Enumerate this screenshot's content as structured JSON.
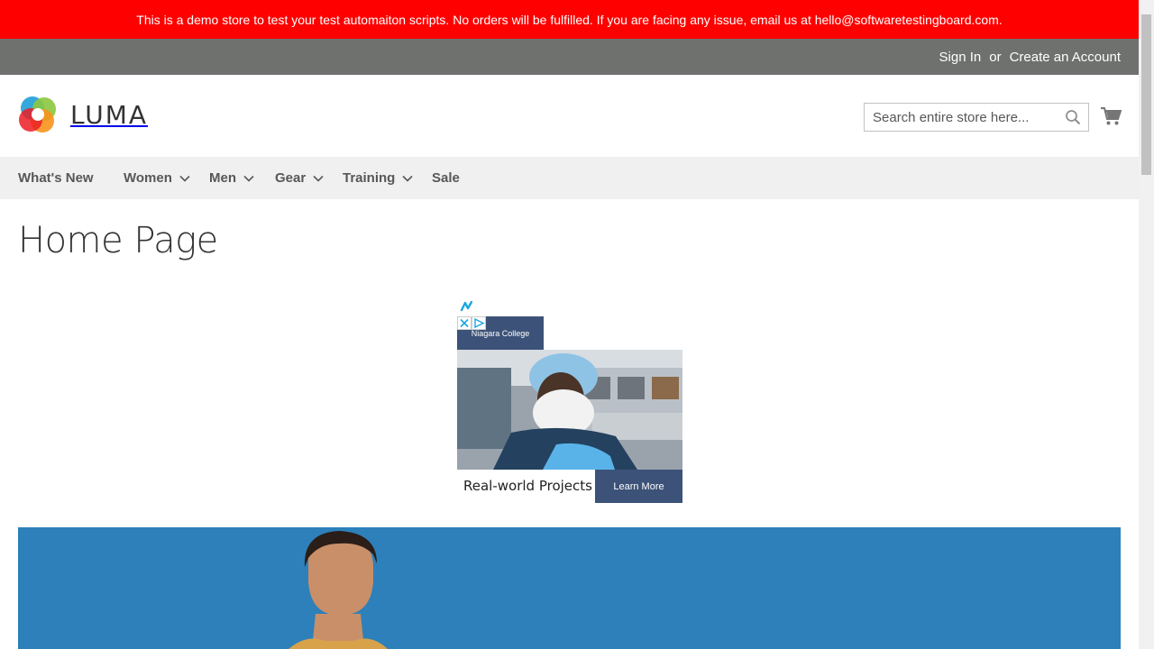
{
  "banner": {
    "text": "This is a demo store to test your test automaiton scripts. No orders will be fulfilled. If you are facing any issue, email us at hello@softwaretestingboard.com."
  },
  "header_links": {
    "sign_in": "Sign In",
    "or": "or",
    "create_account": "Create an Account"
  },
  "logo": {
    "text": "LUMA"
  },
  "search": {
    "placeholder": "Search entire store here..."
  },
  "nav": {
    "items": [
      {
        "label": "What's New",
        "has_dropdown": false
      },
      {
        "label": "Women",
        "has_dropdown": true
      },
      {
        "label": "Men",
        "has_dropdown": true
      },
      {
        "label": "Gear",
        "has_dropdown": true
      },
      {
        "label": "Training",
        "has_dropdown": true
      },
      {
        "label": "Sale",
        "has_dropdown": false
      }
    ]
  },
  "page": {
    "title": "Home Page"
  },
  "ad": {
    "advertiser": "Niagara College",
    "tagline": "Real-world Projects",
    "cta": "Learn More"
  },
  "icons": {
    "search": "search-icon",
    "cart": "cart-icon",
    "chevron": "chevron-down-icon"
  },
  "colors": {
    "banner_bg": "#ff0000",
    "panel_bg": "#6e716e",
    "nav_bg": "#f0f0f0",
    "ad_accent": "#3c5278"
  }
}
